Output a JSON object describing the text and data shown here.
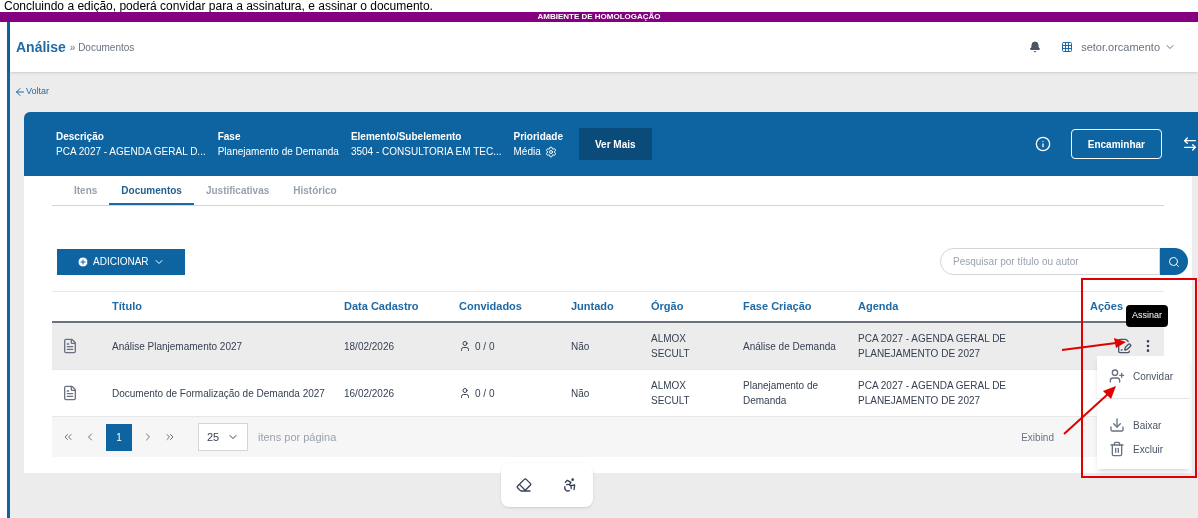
{
  "caption": "Concluindo a edição, poderá convidar para a assinatura, e assinar o documento.",
  "env_banner": "AMBIENTE DE HOMOLOGAÇÃO",
  "breadcrumb": {
    "title": "Análise",
    "trail": "» Documentos"
  },
  "user": "setor.orcamento",
  "back_link": "Voltar",
  "summary": [
    {
      "label": "Descrição",
      "value": "PCA 2027 - AGENDA GERAL D...",
      "kind": "text"
    },
    {
      "label": "Fase",
      "value": "Planejamento de Demanda",
      "kind": "text"
    },
    {
      "label": "Elemento/Subelemento",
      "value": "3504 - CONSULTORIA EM TEC...",
      "kind": "text"
    },
    {
      "label": "Prioridade",
      "value": "Média",
      "kind": "priority"
    }
  ],
  "ver_mais": "Ver Mais",
  "encaminhar": "Encaminhar",
  "tabs": [
    {
      "label": "Itens",
      "selected": false
    },
    {
      "label": "Documentos",
      "selected": true
    },
    {
      "label": "Justificativas",
      "selected": false
    },
    {
      "label": "Histórico",
      "selected": false
    }
  ],
  "add_button": "ADICIONAR",
  "search": {
    "placeholder": "Pesquisar por título ou autor"
  },
  "table": {
    "columns": [
      "Título",
      "Data Cadastro",
      "Convidados",
      "Juntado",
      "Órgão",
      "Fase Criação",
      "Agenda",
      "Ações"
    ],
    "rows": [
      {
        "title": "Análise Planjemamento 2027",
        "date": "18/02/2026",
        "guests": "0 / 0",
        "attached": "Não",
        "org": "ALMOX SECULT",
        "phase": "Análise de Demanda",
        "agenda": "PCA 2027 - AGENDA GERAL DE PLANEJAMENTO DE 2027",
        "selected": true
      },
      {
        "title": "Documento de Formalização de Demanda 2027",
        "date": "16/02/2026",
        "guests": "0 / 0",
        "attached": "Não",
        "org": "ALMOX SECULT",
        "phase": "Planejamento de Demanda",
        "agenda": "PCA 2027 - AGENDA GERAL DE PLANEJAMENTO DE 2027",
        "selected": false
      }
    ]
  },
  "pagination": {
    "page": "1",
    "page_size": "25",
    "per_page_label": "itens por página",
    "summary": "Exibind"
  },
  "tooltip": "Assinar",
  "menu": [
    {
      "label": "Convidar",
      "kind": "invite"
    },
    {
      "label": "Baixar",
      "kind": "download"
    },
    {
      "label": "Excluir",
      "kind": "delete"
    }
  ]
}
